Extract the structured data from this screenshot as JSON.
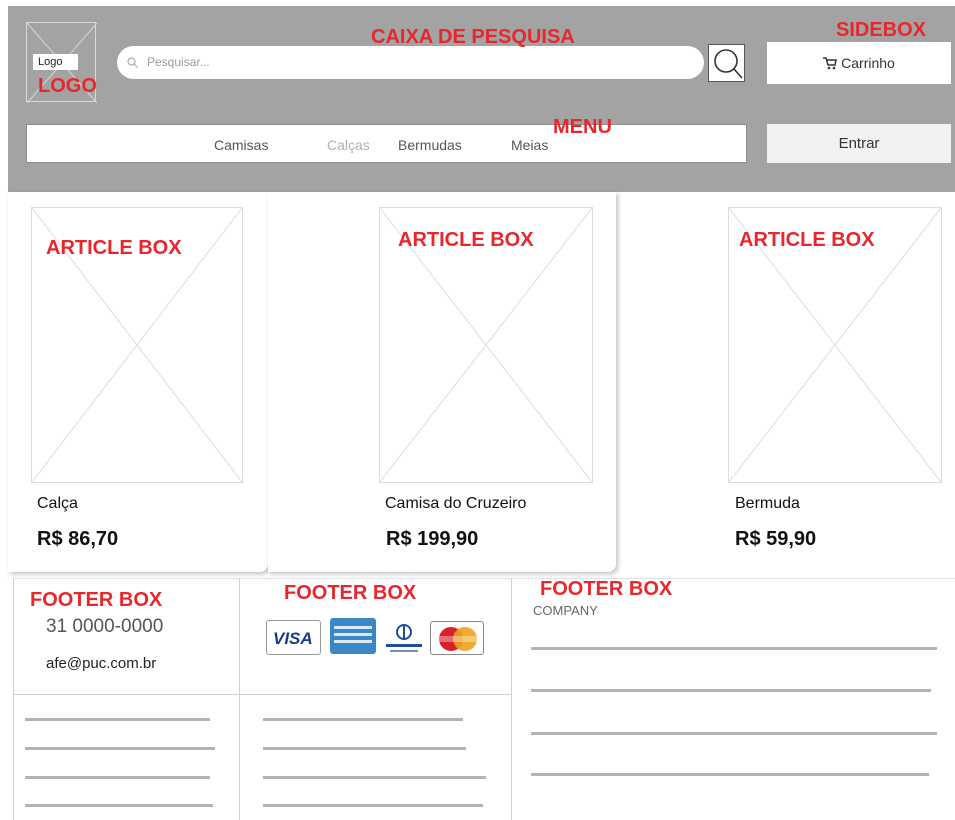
{
  "labels": {
    "caixa_de_pesquisa": "CAIXA DE PESQUISA",
    "sidebox": "SIDEBOX",
    "logo": "LOGO",
    "menu": "MENU",
    "article_box": "ARTICLE BOX",
    "footer_box": "FOOTER BOX"
  },
  "header": {
    "logo_text": "Logo",
    "search_placeholder": "Pesquisar...",
    "cart_label": "Carrinho",
    "login_label": "Entrar",
    "menu_items": [
      "Camisas",
      "Calças",
      "Bermudas",
      "Meias"
    ],
    "menu_item_colors": [
      "#555555",
      "#b0b0b0",
      "#555555",
      "#555555"
    ]
  },
  "products": [
    {
      "name": "Calça",
      "price": "R$ 86,70"
    },
    {
      "name": "Camisa do Cruzeiro",
      "price": "R$ 199,90"
    },
    {
      "name": "Bermuda",
      "price": "R$ 59,90"
    }
  ],
  "footer": {
    "phone": "31 0000-0000",
    "email": "afe@puc.com.br",
    "payment_methods": [
      "VISA",
      "American Express",
      "Diners Club",
      "MasterCard"
    ],
    "company_label": "COMPANY"
  },
  "colors": {
    "header_bg": "#a3a3a3",
    "annotation": "#e8272c",
    "placeholder_line": "#dcdcdc"
  }
}
